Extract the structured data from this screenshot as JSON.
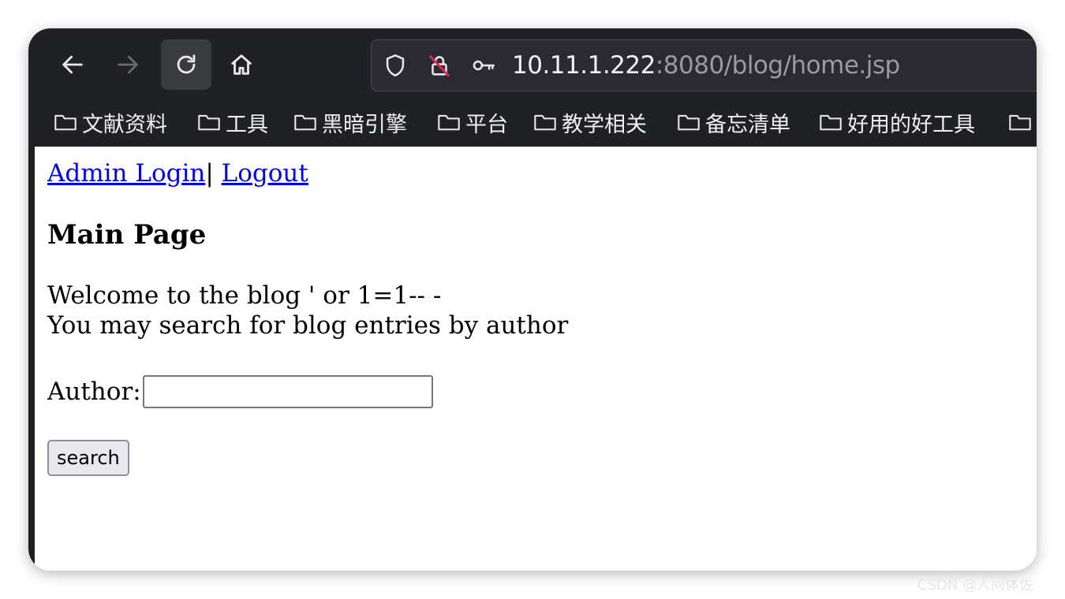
{
  "browser": {
    "nav": {
      "back_icon": "arrow-left-icon",
      "forward_icon": "arrow-right-icon",
      "reload_icon": "reload-icon",
      "home_icon": "home-icon"
    },
    "urlbar": {
      "host": "10.11.1.222",
      "path": ":8080/blog/home.jsp"
    },
    "bookmarks": [
      {
        "label": "文献资料"
      },
      {
        "label": "工具"
      },
      {
        "label": "黑暗引擎"
      },
      {
        "label": "平台"
      },
      {
        "label": "教学相关"
      },
      {
        "label": "备忘清单"
      },
      {
        "label": "好用的好工具"
      }
    ]
  },
  "page": {
    "admin_login": "Admin Login",
    "separator": "| ",
    "logout": "Logout",
    "title": "Main Page",
    "welcome_line1": "Welcome to the blog ' or 1=1-- -",
    "welcome_line2": "You may search for blog entries by author",
    "author_label": "Author:",
    "author_value": "",
    "search_label": "search"
  },
  "watermark": "CSDN @人间体佐",
  "colors": {
    "chrome_bg": "#202124",
    "link": "#0000ee"
  }
}
